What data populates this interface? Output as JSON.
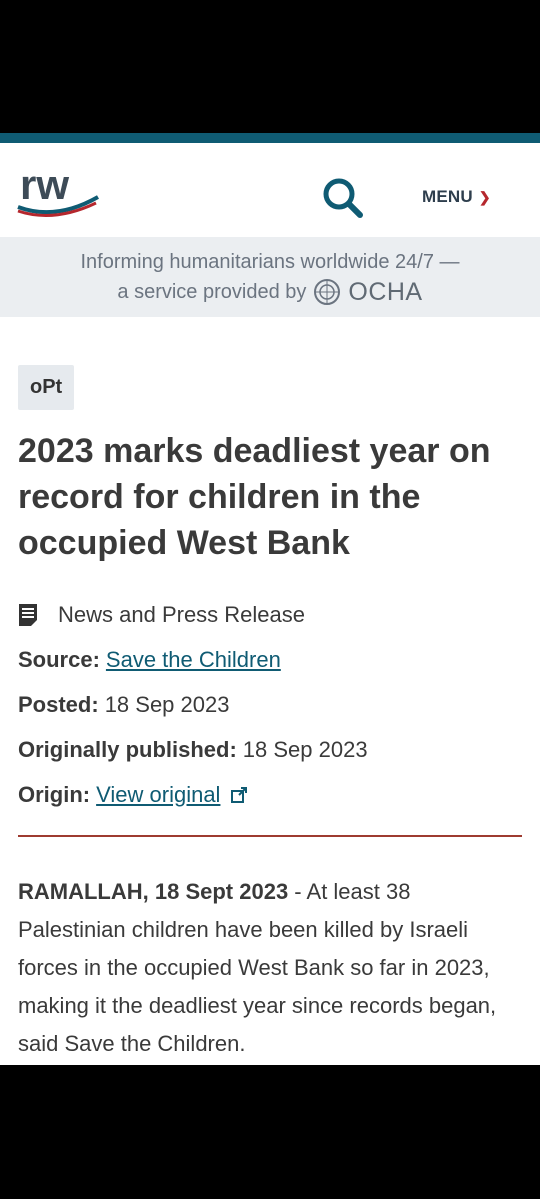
{
  "header": {
    "logo_text": "rw",
    "menu_label": "MENU",
    "tagline_line1": "Informing humanitarians worldwide 24/7 —",
    "tagline_line2": "a service provided by",
    "ocha": "OCHA"
  },
  "article": {
    "country_tag": "oPt",
    "title": "2023 marks deadliest year on record for children in the occupied West Bank",
    "content_format": "News and Press Release",
    "source_label": "Source:",
    "source_value": "Save the Children",
    "posted_label": "Posted:",
    "posted_value": "18 Sep 2023",
    "published_label": "Originally published:",
    "published_value": "18 Sep 2023",
    "origin_label": "Origin:",
    "origin_value": "View original",
    "dateline": "RAMALLAH, 18 Sept 2023",
    "body": " - At least 38 Palestinian children have been killed by Israeli forces in the occupied West Bank so far in 2023, making it the deadliest year since records began, said Save the Children."
  },
  "colors": {
    "brand_teal": "#0f5b73",
    "accent_red": "#b5272d",
    "divider": "#9e3b30"
  },
  "icons": [
    "search-icon",
    "chevron-down-icon",
    "un-emblem-icon",
    "document-icon",
    "external-link-icon"
  ]
}
